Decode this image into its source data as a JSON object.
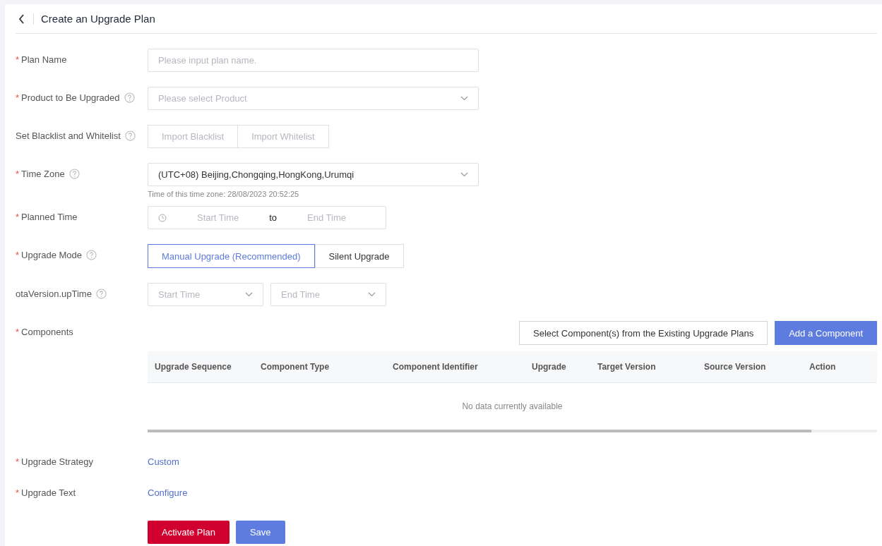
{
  "header": {
    "title": "Create an Upgrade Plan"
  },
  "required_marker": "*",
  "fields": [
    {
      "kind": "text",
      "label": "Plan Name",
      "required": true,
      "help": false,
      "placeholder": "Please input plan name."
    },
    {
      "kind": "select",
      "label": "Product to Be Upgraded",
      "required": true,
      "help": true,
      "placeholder": "Please select Product"
    },
    {
      "kind": "buttons",
      "label": "Set Blacklist and Whitelist",
      "required": false,
      "help": true,
      "buttons": [
        {
          "label": "Import Blacklist",
          "disabled": true
        },
        {
          "label": "Import Whitelist",
          "disabled": true
        }
      ]
    },
    {
      "kind": "select",
      "label": "Time Zone",
      "required": true,
      "help": true,
      "value": "(UTC+08) Beijing,Chongqing,HongKong,Urumqi",
      "hint": "Time of this time zone: 28/08/2023 20:52:25"
    },
    {
      "kind": "daterange",
      "label": "Planned Time",
      "required": true,
      "help": false,
      "start_placeholder": "Start Time",
      "separator": "to",
      "end_placeholder": "End Time"
    },
    {
      "kind": "segmented",
      "label": "Upgrade Mode",
      "required": true,
      "help": true,
      "options": [
        {
          "label": "Manual Upgrade (Recommended)",
          "selected": true
        },
        {
          "label": "Silent Upgrade",
          "selected": false
        }
      ]
    },
    {
      "kind": "selectpair",
      "label": "otaVersion.upTime",
      "required": false,
      "help": true,
      "selects": [
        {
          "placeholder": "Start Time"
        },
        {
          "placeholder": "End Time"
        }
      ]
    },
    {
      "kind": "components",
      "label": "Components",
      "required": true,
      "help": false,
      "buttons": [
        {
          "label": "Select Component(s) from the Existing Upgrade Plans",
          "primary": false
        },
        {
          "label": "Add a Component",
          "primary": true
        }
      ],
      "table": {
        "columns": [
          "Upgrade Sequence",
          "Component Type",
          "Component Identifier",
          "Upgrade",
          "Target Version",
          "Source Version",
          "Action"
        ],
        "empty_text": "No data currently available"
      }
    },
    {
      "kind": "link",
      "label": "Upgrade Strategy",
      "required": true,
      "help": false,
      "link": "Custom"
    },
    {
      "kind": "link",
      "label": "Upgrade Text",
      "required": true,
      "help": false,
      "link": "Configure"
    }
  ],
  "actions": [
    {
      "label": "Activate Plan",
      "kind": "danger"
    },
    {
      "label": "Save",
      "kind": "primary"
    }
  ]
}
